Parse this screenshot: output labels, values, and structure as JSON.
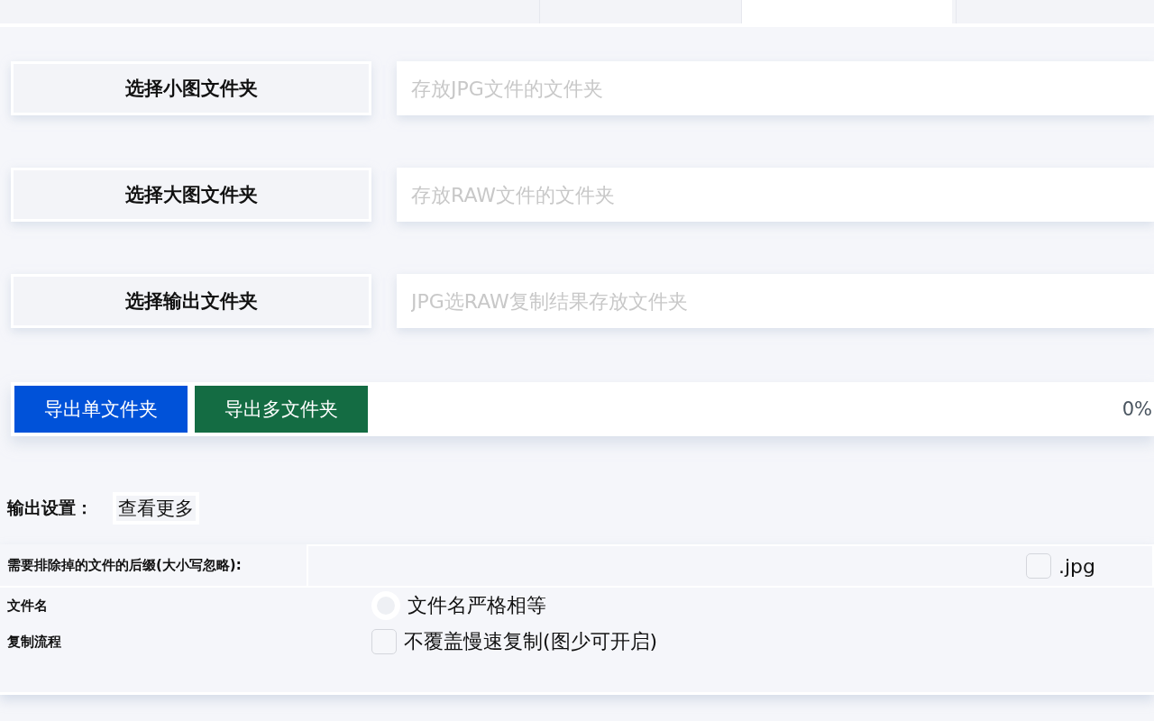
{
  "tabs": [
    {
      "selected": false
    },
    {
      "selected": true
    },
    {
      "selected": false
    }
  ],
  "folders": [
    {
      "button": "选择小图文件夹",
      "placeholder": "存放JPG文件的文件夹"
    },
    {
      "button": "选择大图文件夹",
      "placeholder": "存放RAW文件的文件夹"
    },
    {
      "button": "选择输出文件夹",
      "placeholder": "JPG选RAW复制结果存放文件夹"
    }
  ],
  "export": {
    "buttons": [
      {
        "label": "导出单文件夹",
        "kind": "primary"
      },
      {
        "label": "导出多文件夹",
        "kind": "success"
      }
    ],
    "reading": "0%"
  },
  "output_settings": {
    "title": "输出设置：",
    "more_button": "查看更多"
  },
  "settings": [
    {
      "label": "需要排除掉的文件的后缀(大小写忽略):",
      "kind": "checkbox",
      "options": [
        {
          "label": ".jpg",
          "checked": false
        }
      ]
    },
    {
      "label": "文件名",
      "kind": "radio",
      "options": [
        {
          "label": "文件名严格相等",
          "checked": false
        }
      ]
    },
    {
      "label": "复制流程",
      "kind": "checkbox",
      "options": [
        {
          "label": "不覆盖慢速复制(图少可开启)",
          "checked": false
        }
      ]
    }
  ]
}
